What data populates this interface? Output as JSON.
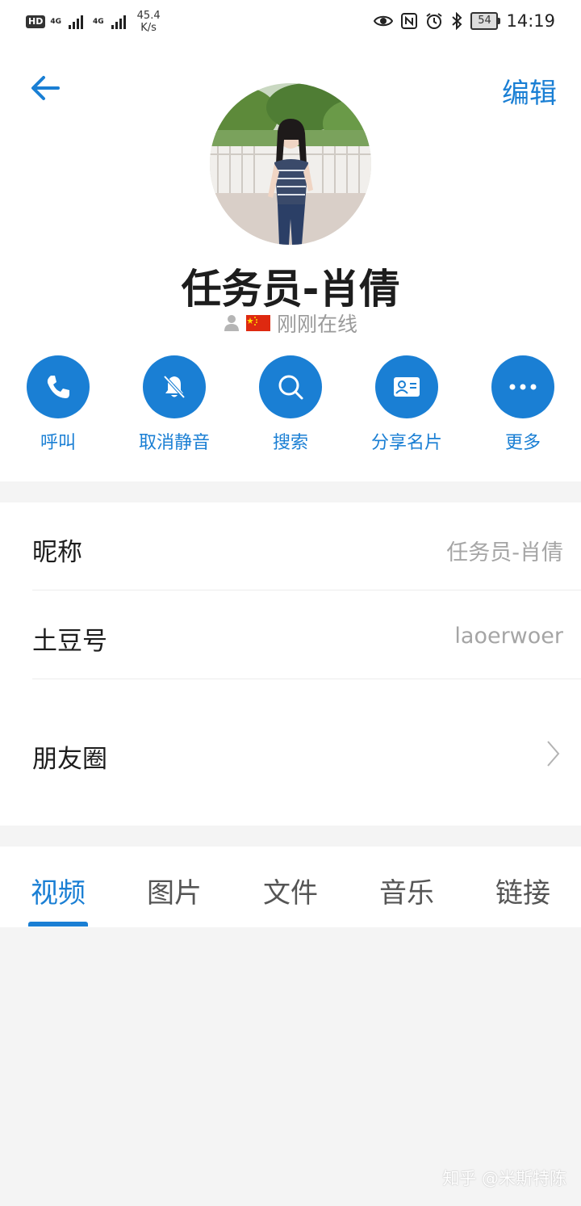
{
  "status_bar": {
    "hd": "HD",
    "sim1_tag": "4G",
    "sim2_tag": "4G",
    "speed_value": "45.4",
    "speed_unit": "K/s",
    "battery": "54",
    "time": "14:19",
    "icons": [
      "eye-icon",
      "nfc-icon",
      "alarm-icon",
      "bluetooth-icon",
      "battery-icon"
    ]
  },
  "header": {
    "back_icon": "arrow-left-icon",
    "edit_label": "编辑"
  },
  "profile": {
    "name": "任务员-肖倩",
    "status_text": "刚刚在线"
  },
  "actions": [
    {
      "label": "呼叫",
      "icon": "phone-icon"
    },
    {
      "label": "取消静音",
      "icon": "bell-off-icon"
    },
    {
      "label": "搜索",
      "icon": "search-icon"
    },
    {
      "label": "分享名片",
      "icon": "contact-card-icon"
    },
    {
      "label": "更多",
      "icon": "more-icon"
    }
  ],
  "info": {
    "nickname_label": "昵称",
    "nickname_value": "任务员-肖倩",
    "id_label": "土豆号",
    "id_value": "laoerwoer",
    "moments_label": "朋友圈"
  },
  "tabs": [
    {
      "label": "视频",
      "active": true
    },
    {
      "label": "图片",
      "active": false
    },
    {
      "label": "文件",
      "active": false
    },
    {
      "label": "音乐",
      "active": false
    },
    {
      "label": "链接",
      "active": false
    }
  ],
  "watermark": "知乎 @米斯特陈",
  "colors": {
    "accent": "#1a7fd4",
    "text_primary": "#1d1d1d",
    "text_secondary": "#a5a5a5",
    "band": "#f4f4f4"
  }
}
